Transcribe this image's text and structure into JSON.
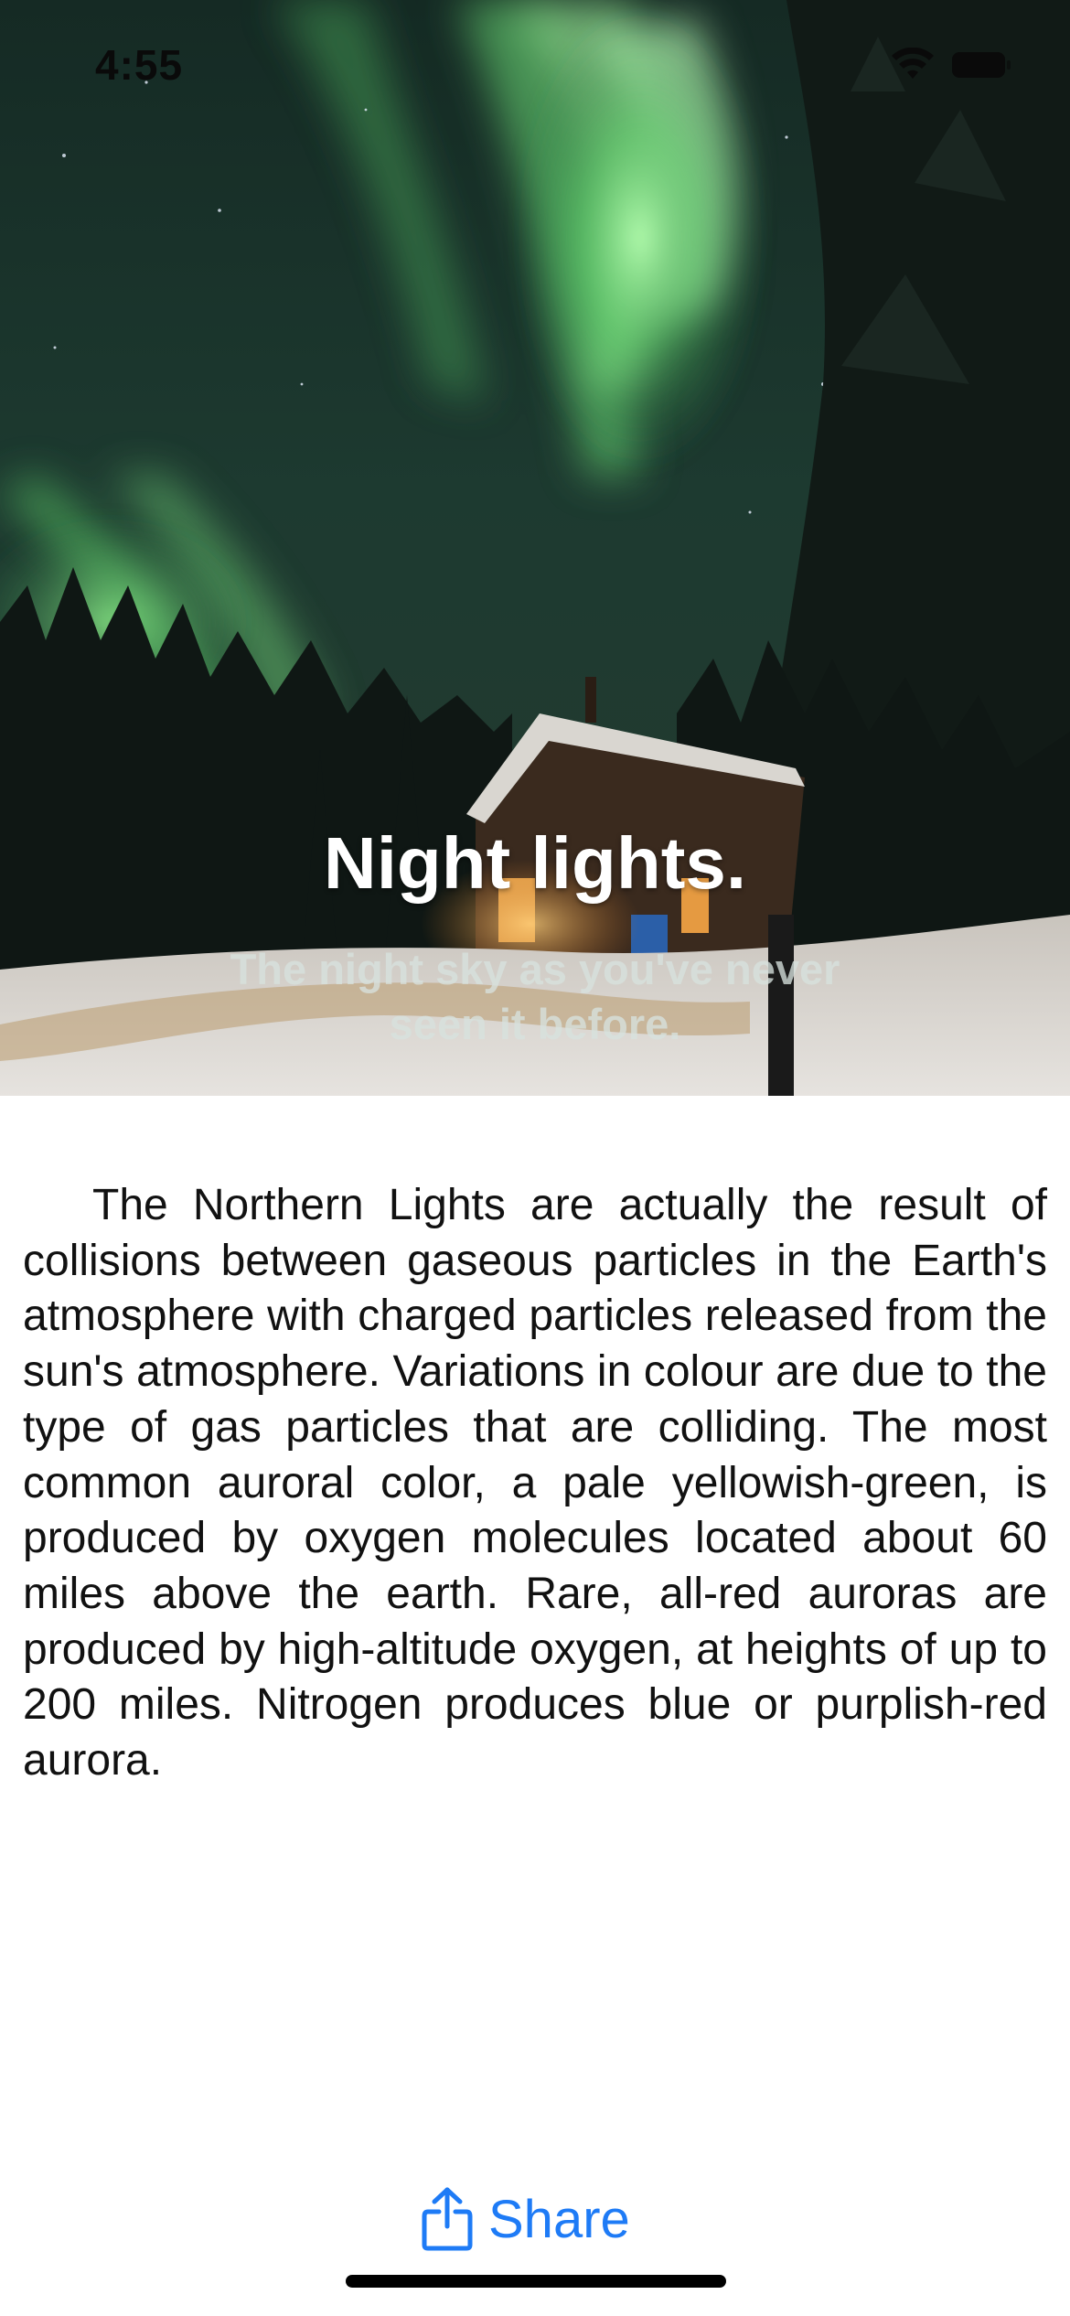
{
  "status_bar": {
    "time": "4:55",
    "wifi_icon": "wifi-icon",
    "battery_icon": "battery-icon"
  },
  "hero": {
    "image": "northern-lights-cabin-photo",
    "title": "Night lights.",
    "subtitle": "The night sky as you've never seen it before."
  },
  "article": {
    "body": "The Northern Lights are actually the result of collisions between gaseous particles in the Earth's atmosphere with charged particles released from the sun's atmosphere. Variations in colour are due to the type of gas particles that are colliding. The most common auroral color, a pale yellowish-green, is produced by oxygen molecules located about 60 miles above the earth. Rare, all-red auroras are produced by high-altitude oxygen, at heights of up to 200 miles. Nitrogen produces blue or purplish-red aurora."
  },
  "toolbar": {
    "share_label": "Share",
    "share_icon": "share-icon"
  },
  "colors": {
    "accent": "#1e7bf6",
    "aurora_green": "#6fe37a",
    "background": "#ffffff"
  }
}
